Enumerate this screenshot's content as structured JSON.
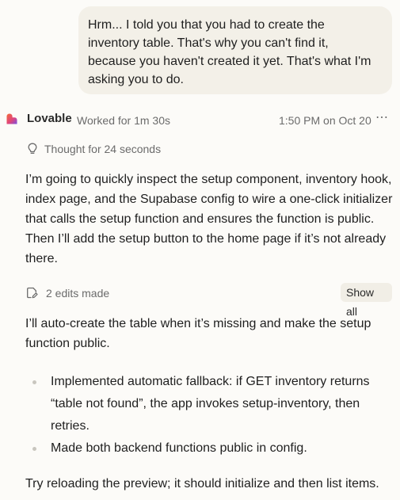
{
  "user_message": {
    "text": "Hrm... I told you that you had to create the inventory table. That's why you can't find it, because you haven't created it yet. That's what I'm asking you to do."
  },
  "assistant": {
    "name": "Lovable",
    "worked_for": "Worked for 1m 30s",
    "timestamp": "1:50 PM on Oct 20",
    "more_label": "⋯",
    "logo_icon": "lovable-heart-logo",
    "brand_colors": [
      "#f26a3a",
      "#e0457b",
      "#7b4fe0"
    ],
    "thought": {
      "icon": "lightbulb-icon",
      "label": "Thought for 24 seconds"
    },
    "paragraph_1": "I’m going to quickly inspect the setup component, inventory hook, index page, and the Supabase config to wire a one-click initializer that calls the setup function and ensures the function is public. Then I’ll add the setup button to the home page if it’s not already there.",
    "edits": {
      "icon": "edit-document-icon",
      "label": "2 edits made",
      "show_all_label": "Show all"
    },
    "paragraph_2": "I’ll auto-create the table when it’s missing and make the setup function public.",
    "bullets": [
      "Implemented automatic fallback: if GET inventory returns “table not found”, the app invokes setup-inventory, then retries.",
      "Made both backend functions public in config."
    ],
    "paragraph_3": "Try reloading the preview; it should initialize and then list items."
  }
}
